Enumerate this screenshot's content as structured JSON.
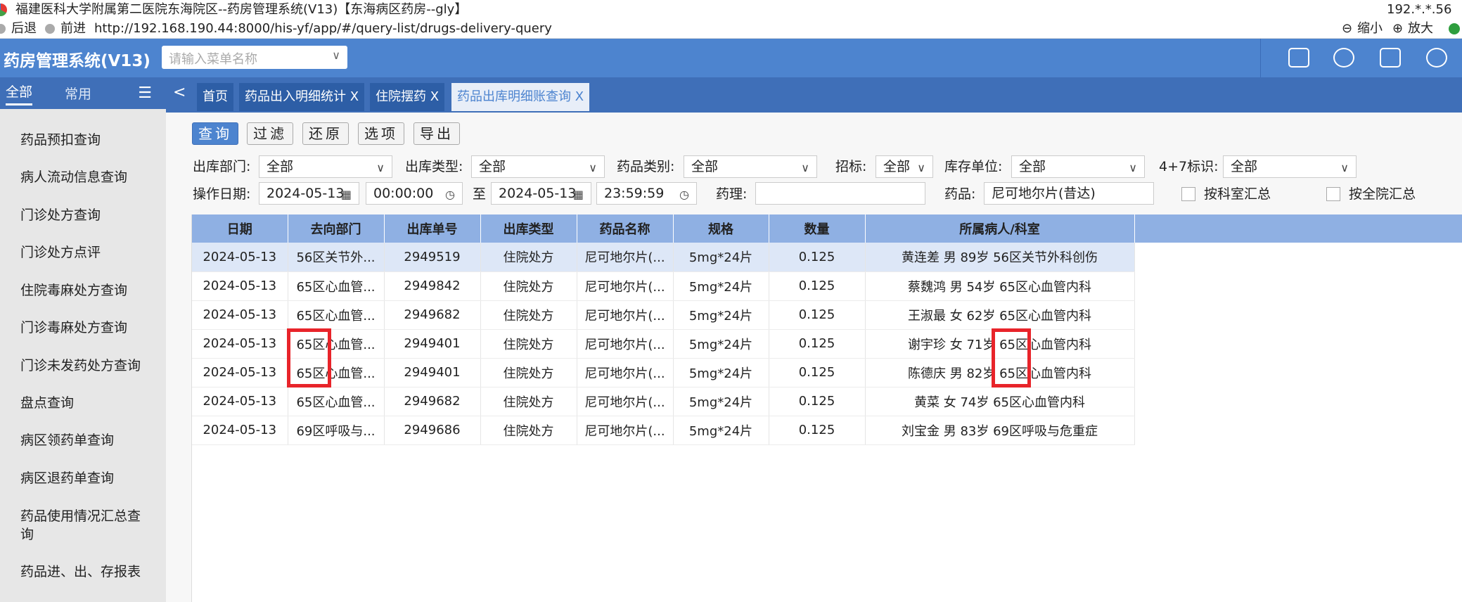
{
  "window": {
    "title": "福建医科大学附属第二医院东海院区--药房管理系统(V13)【东海病区药房--gly】",
    "ip": "192.*.*.56",
    "back": "后退",
    "forward": "前进",
    "url": "http://192.168.190.44:8000/his-yf/app/#/query-list/drugs-delivery-query",
    "zoom_out": "缩小",
    "zoom_in": "放大"
  },
  "header": {
    "app_name": "药房管理系统(V13)",
    "menu_search_placeholder": "请输入菜单名称"
  },
  "sidebar": {
    "tab_all": "全部",
    "tab_common": "常用",
    "items": [
      "药品预扣查询",
      "病人流动信息查询",
      "门诊处方查询",
      "门诊处方点评",
      "住院毒麻处方查询",
      "门诊毒麻处方查询",
      "门诊未发药处方查询",
      "盘点查询",
      "病区领药单查询",
      "病区退药单查询",
      "药品使用情况汇总查询",
      "药品进、出、存报表"
    ]
  },
  "tabs": [
    {
      "label": "首页"
    },
    {
      "label": "药品出入明细统计",
      "close": "X"
    },
    {
      "label": "住院摆药",
      "close": "X"
    },
    {
      "label": "药品出库明细账查询",
      "close": "X"
    }
  ],
  "toolbar": {
    "query": "查询",
    "filter": "过滤",
    "reset": "还原",
    "options": "选项",
    "export": "导出"
  },
  "filters": {
    "out_dept_label": "出库部门:",
    "out_dept_value": "全部",
    "out_type_label": "出库类型:",
    "out_type_value": "全部",
    "drug_cat_label": "药品类别:",
    "drug_cat_value": "全部",
    "bid_label": "招标:",
    "bid_value": "全部",
    "stock_unit_label": "库存单位:",
    "stock_unit_value": "全部",
    "four_seven_label": "4+7标识:",
    "four_seven_value": "全部",
    "op_date_label": "操作日期:",
    "date_from": "2024-05-13",
    "time_from": "00:00:00",
    "to_label": "至",
    "date_to": "2024-05-13",
    "time_to": "23:59:59",
    "pharm_label": "药理:",
    "pharm_value": "",
    "drug_label": "药品:",
    "drug_value": "尼可地尔片(昔达)",
    "by_dept_label": "按科室汇总",
    "by_hospital_label": "按全院汇总"
  },
  "table": {
    "columns": [
      "日期",
      "去向部门",
      "出库单号",
      "出库类型",
      "药品名称",
      "规格",
      "数量",
      "所属病人/科室"
    ],
    "rows": [
      [
        "2024-05-13",
        "56区关节外...",
        "2949519",
        "住院处方",
        "尼可地尔片(...",
        "5mg*24片",
        "0.125",
        "黄连差 男 89岁 56区关节外科创伤"
      ],
      [
        "2024-05-13",
        "65区心血管...",
        "2949842",
        "住院处方",
        "尼可地尔片(...",
        "5mg*24片",
        "0.125",
        "蔡魏鸿 男 54岁 65区心血管内科"
      ],
      [
        "2024-05-13",
        "65区心血管...",
        "2949682",
        "住院处方",
        "尼可地尔片(...",
        "5mg*24片",
        "0.125",
        "王淑最 女 62岁 65区心血管内科"
      ],
      [
        "2024-05-13",
        "65区心血管...",
        "2949401",
        "住院处方",
        "尼可地尔片(...",
        "5mg*24片",
        "0.125",
        "谢宇珍 女 71岁 65区心血管内科"
      ],
      [
        "2024-05-13",
        "65区心血管...",
        "2949401",
        "住院处方",
        "尼可地尔片(...",
        "5mg*24片",
        "0.125",
        "陈德庆 男 82岁 65区心血管内科"
      ],
      [
        "2024-05-13",
        "65区心血管...",
        "2949682",
        "住院处方",
        "尼可地尔片(...",
        "5mg*24片",
        "0.125",
        "黄菜 女 74岁 65区心血管内科"
      ],
      [
        "2024-05-13",
        "69区呼吸与...",
        "2949686",
        "住院处方",
        "尼可地尔片(...",
        "5mg*24片",
        "0.125",
        "刘宝金 男 83岁 69区呼吸与危重症"
      ]
    ]
  },
  "colors": {
    "header_blue": "#4d84cf",
    "tab_bar_blue": "#3f6fb8",
    "highlight_red": "#e8242a"
  }
}
